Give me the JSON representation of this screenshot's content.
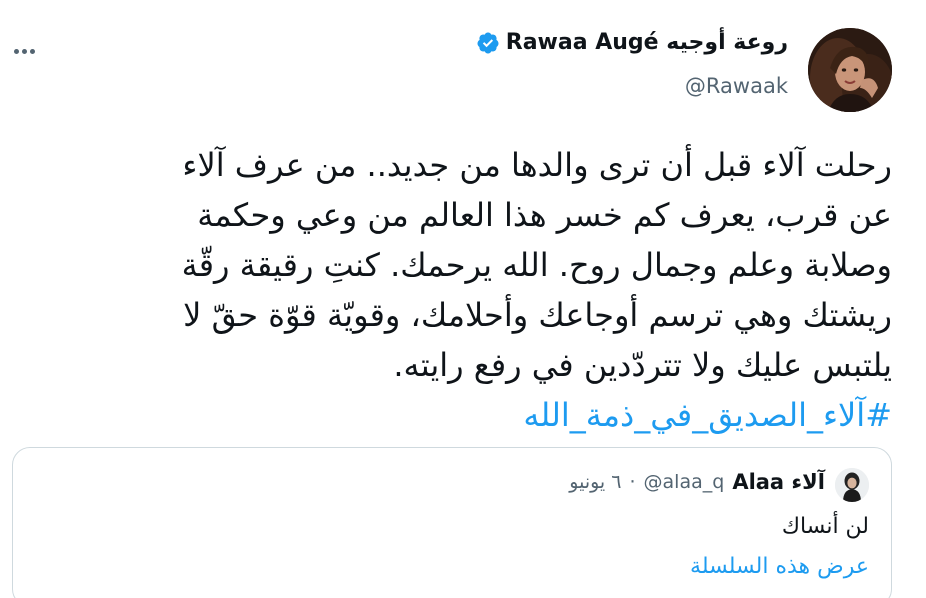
{
  "tweet": {
    "author": {
      "display_name": "روعة أوجيه Rawaa Augé",
      "handle": "@Rawaak",
      "verified": true,
      "verified_icon": "verified-badge-icon",
      "avatar": "profile-photo"
    },
    "more_icon": "more-horizontal-icon",
    "text_lines": [
      "رحلت آلاء قبل أن ترى والدها من جديد.. من عرف آلاء",
      "عن قرب، يعرف كم خسر هذا العالم من وعي وحكمة",
      "وصلابة وعلم وجمال روح. الله يرحمك. كنتِ رقيقة رقّة",
      "ريشتك وهي ترسم أوجاعك وأحلامك، وقويّة قوّة حقّ لا",
      "يلتبس عليك ولا تتردّدين في رفع رايته."
    ],
    "hashtag": "#آلاء_الصديق_في_ذمة_الله"
  },
  "quoted_tweet": {
    "display_name": "آلاء Alaa",
    "handle": "@alaa_q",
    "separator": "·",
    "date": "٦ يونيو",
    "text": "لن أنساك",
    "show_thread_label": "عرض هذه السلسلة"
  },
  "colors": {
    "accent": "#1d9bf0",
    "text": "#0f1419",
    "secondary": "#536471",
    "border": "#cfd9de"
  }
}
